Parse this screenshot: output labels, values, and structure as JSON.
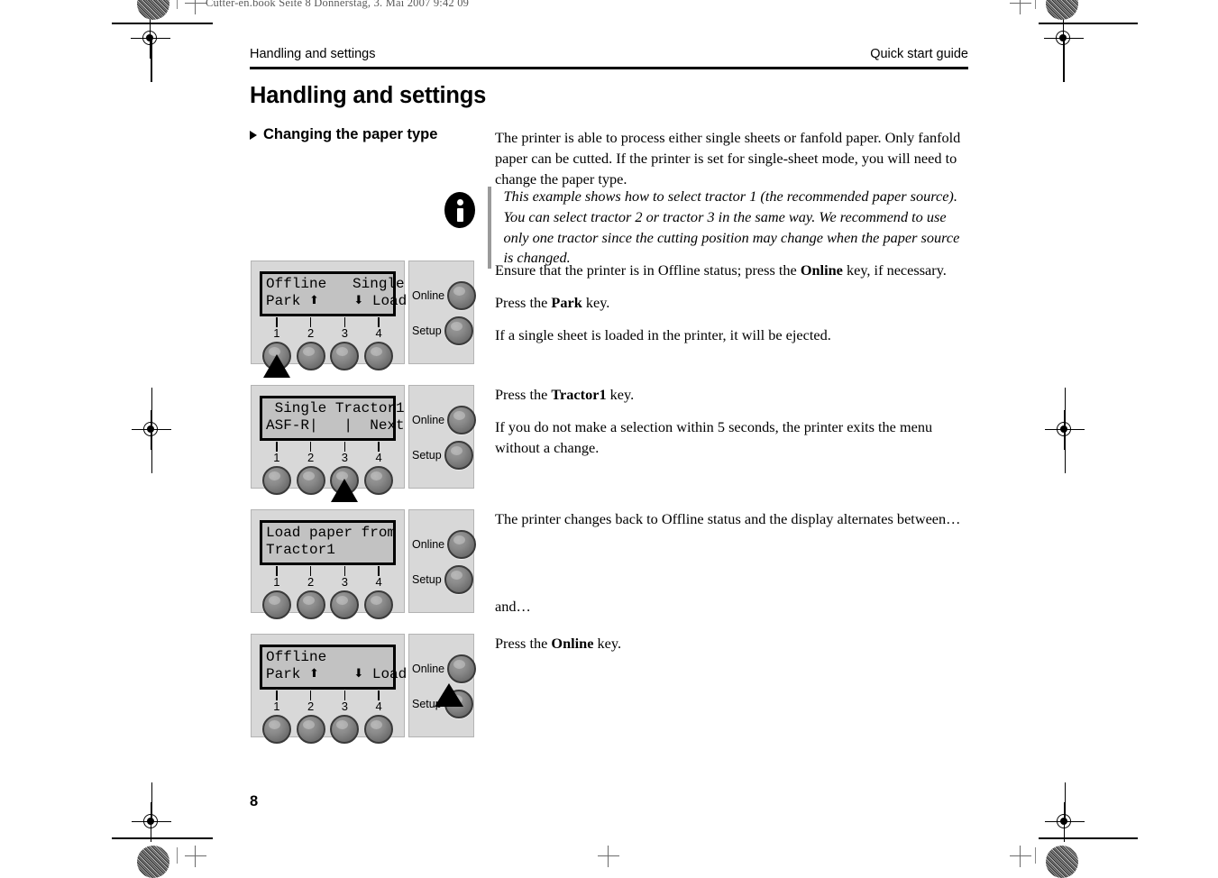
{
  "file_stamp": "Cutter-en.book  Seite 8  Donnerstag, 3. Mai 2007  9:42 09",
  "running_head": {
    "left": "Handling and settings",
    "right": "Quick start guide"
  },
  "chapter_title": "Handling and settings",
  "section": {
    "heading": "Changing the paper type",
    "intro": "The printer is able to process either single sheets or fanfold paper. Only fanfold paper can be cutted. If the printer is set for single-sheet mode, you will need to change the paper type."
  },
  "note": {
    "icon": "info-icon",
    "text": "This example shows how to select tractor 1 (the recommended paper source). You can select tractor 2 or tractor 3 in the same way. We recommend to use only one tractor since the cutting position may change when the paper source is changed."
  },
  "side_buttons": {
    "online": "Online",
    "setup": "Setup"
  },
  "button_numbers": [
    "1",
    "2",
    "3",
    "4"
  ],
  "steps": [
    {
      "panel": {
        "lcd_line1": "Offline   Single",
        "lcd_line2_left": "Park ",
        "lcd_line2_up": "⬆",
        "lcd_line2_mid": "    ",
        "lcd_line2_down": "⬇",
        "lcd_line2_right": " Load",
        "pointer": "button-1"
      },
      "texts": [
        "Ensure that the printer is in Offline status; press the <b>Online</b> key, if necessary.",
        "Press the <b>Park</b> key.",
        "If a single sheet is loaded in the printer, it will be ejected."
      ]
    },
    {
      "panel": {
        "lcd_line1": " Single Tractor1",
        "lcd_line2_left": "ASF-R|",
        "lcd_line2_up": "",
        "lcd_line2_mid": "   |",
        "lcd_line2_down": "",
        "lcd_line2_right": "  Next",
        "pointer": "button-3"
      },
      "texts": [
        "Press the <b>Tractor1</b> key.",
        "If you do not make a selection within 5 seconds, the printer exits the menu without a change."
      ]
    },
    {
      "panel": {
        "lcd_line1": "Load paper from",
        "lcd_line2_left": "Tractor1",
        "lcd_line2_up": "",
        "lcd_line2_mid": "",
        "lcd_line2_down": "",
        "lcd_line2_right": "",
        "pointer": "none"
      },
      "texts": [
        "The printer changes back to Offline status and the display alternates between…",
        "and…"
      ]
    },
    {
      "panel": {
        "lcd_line1": "Offline",
        "lcd_line2_left": "Park ",
        "lcd_line2_up": "⬆",
        "lcd_line2_mid": "    ",
        "lcd_line2_down": "⬇",
        "lcd_line2_right": " Load",
        "pointer": "online-button"
      },
      "texts": [
        "Press the <b>Online</b> key."
      ]
    }
  ],
  "page_number": "8"
}
